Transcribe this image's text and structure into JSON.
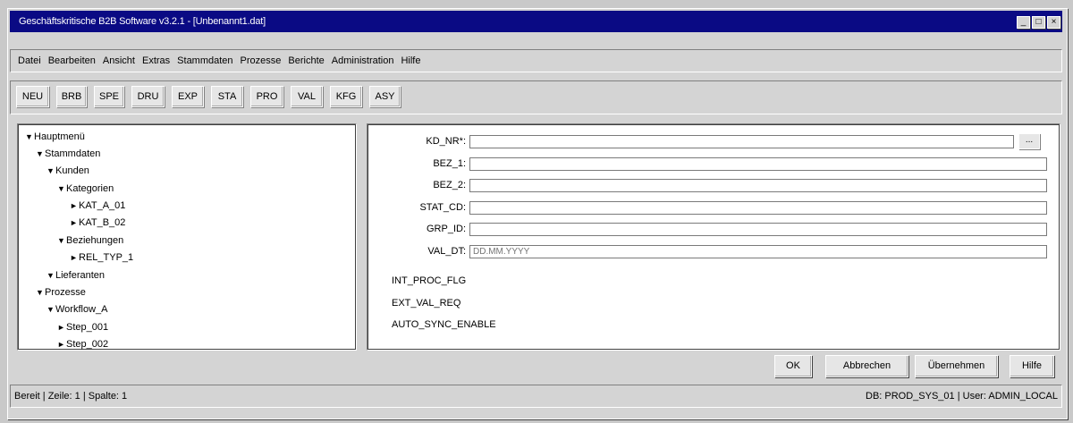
{
  "window": {
    "title": "Geschäftskritische B2B Software v3.2.1 - [Unbenannt1.dat]",
    "controls": {
      "minimize": "_",
      "maximize": "□",
      "close": "×"
    }
  },
  "menu": [
    "Datei",
    "Bearbeiten",
    "Ansicht",
    "Extras",
    "Stammdaten",
    "Prozesse",
    "Berichte",
    "Administration",
    "Hilfe"
  ],
  "toolbar": [
    "NEU",
    "BRB",
    "SPE",
    "DRU",
    "EXP",
    "STA",
    "PRO",
    "VAL",
    "KFG",
    "ASY"
  ],
  "tree": [
    {
      "label": "Hauptmenü",
      "arrow": "▼"
    },
    {
      "label": "Stammdaten",
      "arrow": "▼"
    },
    {
      "label": "Kunden",
      "arrow": "▼"
    },
    {
      "label": "Kategorien",
      "arrow": "▼"
    },
    {
      "label": "KAT_A_01",
      "arrow": "►"
    },
    {
      "label": "KAT_B_02",
      "arrow": "►"
    },
    {
      "label": "Beziehungen",
      "arrow": "▼"
    },
    {
      "label": "REL_TYP_1",
      "arrow": "►"
    },
    {
      "label": "Lieferanten",
      "arrow": "▼"
    },
    {
      "label": "Prozesse",
      "arrow": "▼"
    },
    {
      "label": "Workflow_A",
      "arrow": "▼"
    },
    {
      "label": "Step_001",
      "arrow": "►"
    },
    {
      "label": "Step_002",
      "arrow": "►"
    }
  ],
  "form": {
    "fields": [
      {
        "label": "KD_NR*:",
        "value": "",
        "placeholder": ""
      },
      {
        "label": "BEZ_1:",
        "value": "",
        "placeholder": ""
      },
      {
        "label": "BEZ_2:",
        "value": "",
        "placeholder": ""
      },
      {
        "label": "STAT_CD:",
        "value": "",
        "placeholder": ""
      },
      {
        "label": "GRP_ID:",
        "value": "",
        "placeholder": ""
      },
      {
        "label": "VAL_DT:",
        "value": "",
        "placeholder": "DD.MM.YYYY"
      }
    ],
    "browse_label": "...",
    "flags": [
      "INT_PROC_FLG",
      "EXT_VAL_REQ",
      "AUTO_SYNC_ENABLE"
    ]
  },
  "dialog_buttons": {
    "ok": "OK",
    "cancel": "Abbrechen",
    "apply": "Übernehmen",
    "help": "Hilfe"
  },
  "status": {
    "left": "Bereit | Zeile: 1 | Spalte: 1",
    "right": "DB: PROD_SYS_01 | User: ADMIN_LOCAL"
  },
  "colors": {
    "titlebar": "#0a0a84",
    "face": "#d4d4d4",
    "desktop": "#c9c9c9"
  }
}
